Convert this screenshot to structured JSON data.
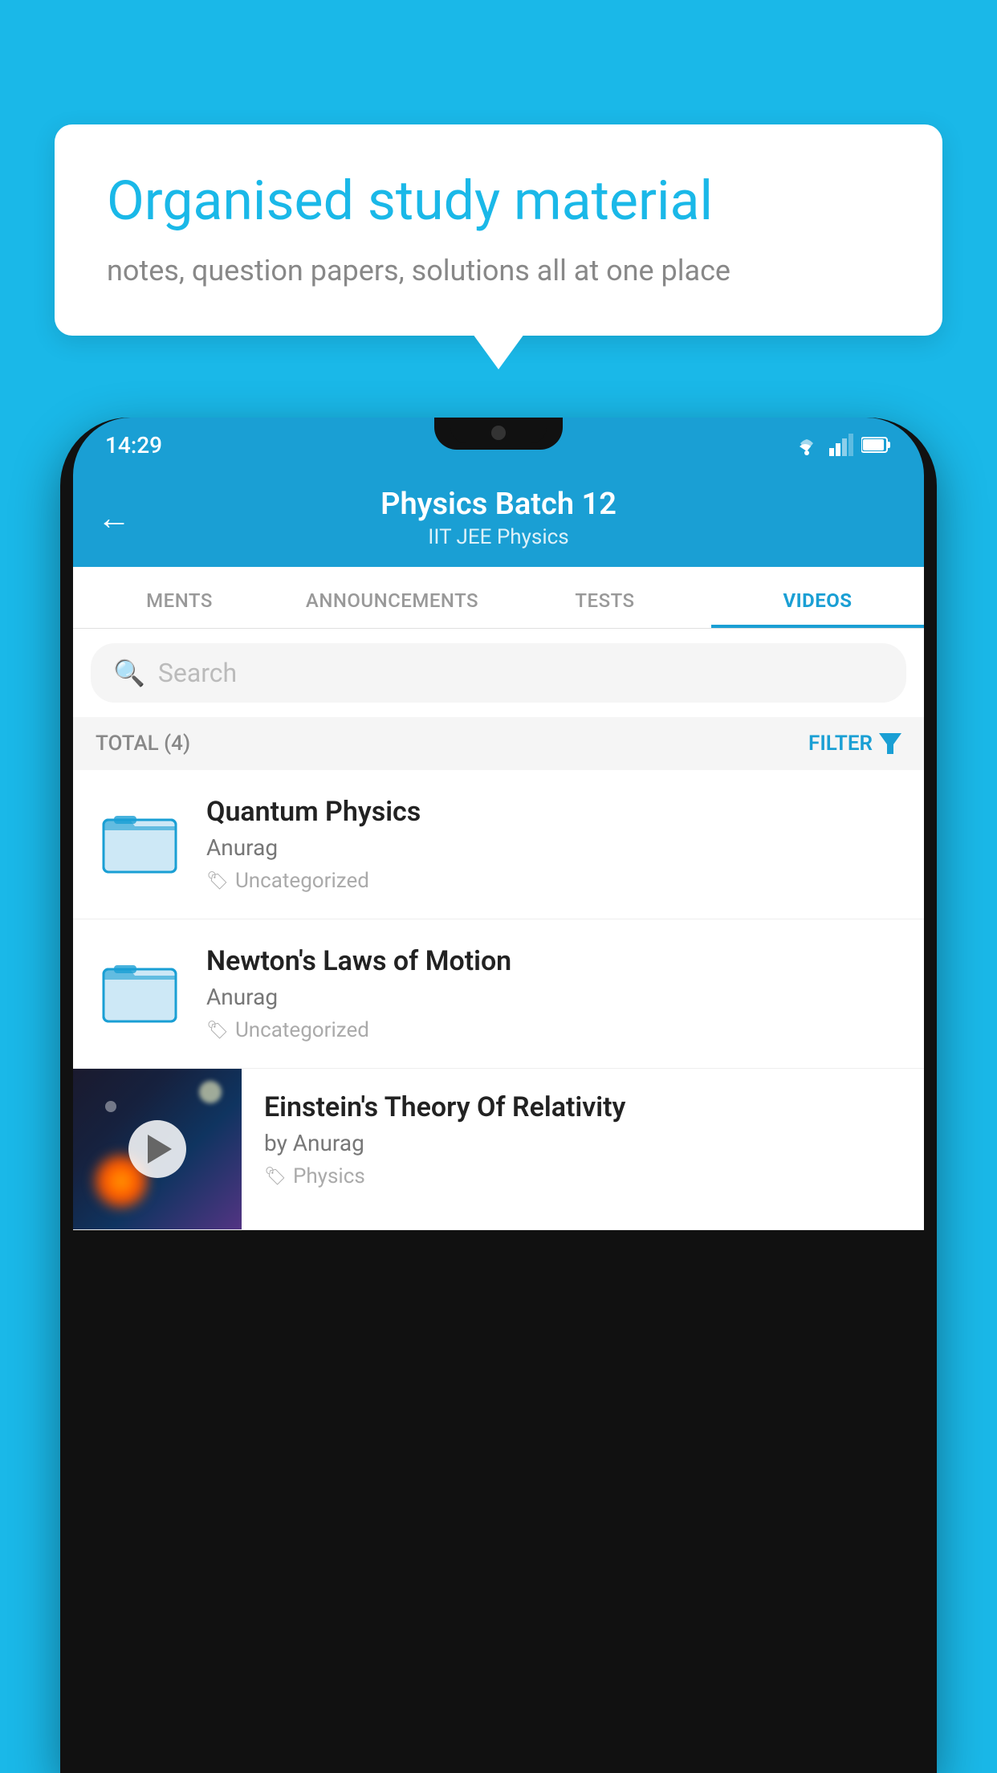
{
  "background": {
    "color": "#1ab8e8"
  },
  "speech_bubble": {
    "title": "Organised study material",
    "subtitle": "notes, question papers, solutions all at one place"
  },
  "phone": {
    "status_bar": {
      "time": "14:29"
    },
    "nav_bar": {
      "title": "Physics Batch 12",
      "subtitle": "IIT JEE   Physics",
      "back_label": "←"
    },
    "tabs": [
      {
        "label": "MENTS",
        "active": false
      },
      {
        "label": "ANNOUNCEMENTS",
        "active": false
      },
      {
        "label": "TESTS",
        "active": false
      },
      {
        "label": "VIDEOS",
        "active": true
      }
    ],
    "search": {
      "placeholder": "Search"
    },
    "filter_bar": {
      "total_label": "TOTAL (4)",
      "filter_label": "FILTER"
    },
    "videos": [
      {
        "title": "Quantum Physics",
        "author": "Anurag",
        "tag": "Uncategorized",
        "has_thumb": false
      },
      {
        "title": "Newton's Laws of Motion",
        "author": "Anurag",
        "tag": "Uncategorized",
        "has_thumb": false
      },
      {
        "title": "Einstein's Theory Of Relativity",
        "author": "by Anurag",
        "tag": "Physics",
        "has_thumb": true
      }
    ]
  }
}
